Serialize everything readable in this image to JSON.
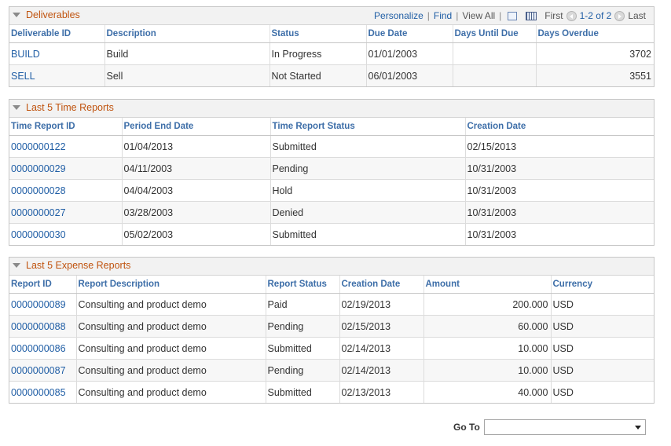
{
  "nav": {
    "personalize": "Personalize",
    "find": "Find",
    "view_all": "View All",
    "first": "First",
    "range": "1-2 of 2",
    "last": "Last"
  },
  "deliverables": {
    "title": "Deliverables",
    "columns": [
      "Deliverable ID",
      "Description",
      "Status",
      "Due Date",
      "Days Until Due",
      "Days Overdue"
    ],
    "rows": [
      {
        "id": "BUILD",
        "description": "Build",
        "status": "In Progress",
        "due_date": "01/01/2003",
        "days_until_due": "",
        "days_overdue": "3702"
      },
      {
        "id": "SELL",
        "description": "Sell",
        "status": "Not Started",
        "due_date": "06/01/2003",
        "days_until_due": "",
        "days_overdue": "3551"
      }
    ]
  },
  "time_reports": {
    "title": "Last 5 Time Reports",
    "columns": [
      "Time Report ID",
      "Period End Date",
      "Time Report Status",
      "Creation Date"
    ],
    "rows": [
      {
        "id": "0000000122",
        "period_end": "01/04/2013",
        "status": "Submitted",
        "created": "02/15/2013"
      },
      {
        "id": "0000000029",
        "period_end": "04/11/2003",
        "status": "Pending",
        "created": "10/31/2003"
      },
      {
        "id": "0000000028",
        "period_end": "04/04/2003",
        "status": "Hold",
        "created": "10/31/2003"
      },
      {
        "id": "0000000027",
        "period_end": "03/28/2003",
        "status": "Denied",
        "created": "10/31/2003"
      },
      {
        "id": "0000000030",
        "period_end": "05/02/2003",
        "status": "Submitted",
        "created": "10/31/2003"
      }
    ]
  },
  "expense_reports": {
    "title": "Last 5 Expense Reports",
    "columns": [
      "Report ID",
      "Report Description",
      "Report Status",
      "Creation Date",
      "Amount",
      "Currency"
    ],
    "rows": [
      {
        "id": "0000000089",
        "description": "Consulting and product demo",
        "status": "Paid",
        "created": "02/19/2013",
        "amount": "200.000",
        "currency": "USD"
      },
      {
        "id": "0000000088",
        "description": "Consulting and product demo",
        "status": "Pending",
        "created": "02/15/2013",
        "amount": "60.000",
        "currency": "USD"
      },
      {
        "id": "0000000086",
        "description": "Consulting and product demo",
        "status": "Submitted",
        "created": "02/14/2013",
        "amount": "10.000",
        "currency": "USD"
      },
      {
        "id": "0000000087",
        "description": "Consulting and product demo",
        "status": "Pending",
        "created": "02/14/2013",
        "amount": "10.000",
        "currency": "USD"
      },
      {
        "id": "0000000085",
        "description": "Consulting and product demo",
        "status": "Submitted",
        "created": "02/13/2013",
        "amount": "40.000",
        "currency": "USD"
      }
    ]
  },
  "goto": {
    "label": "Go To",
    "selected": ""
  }
}
